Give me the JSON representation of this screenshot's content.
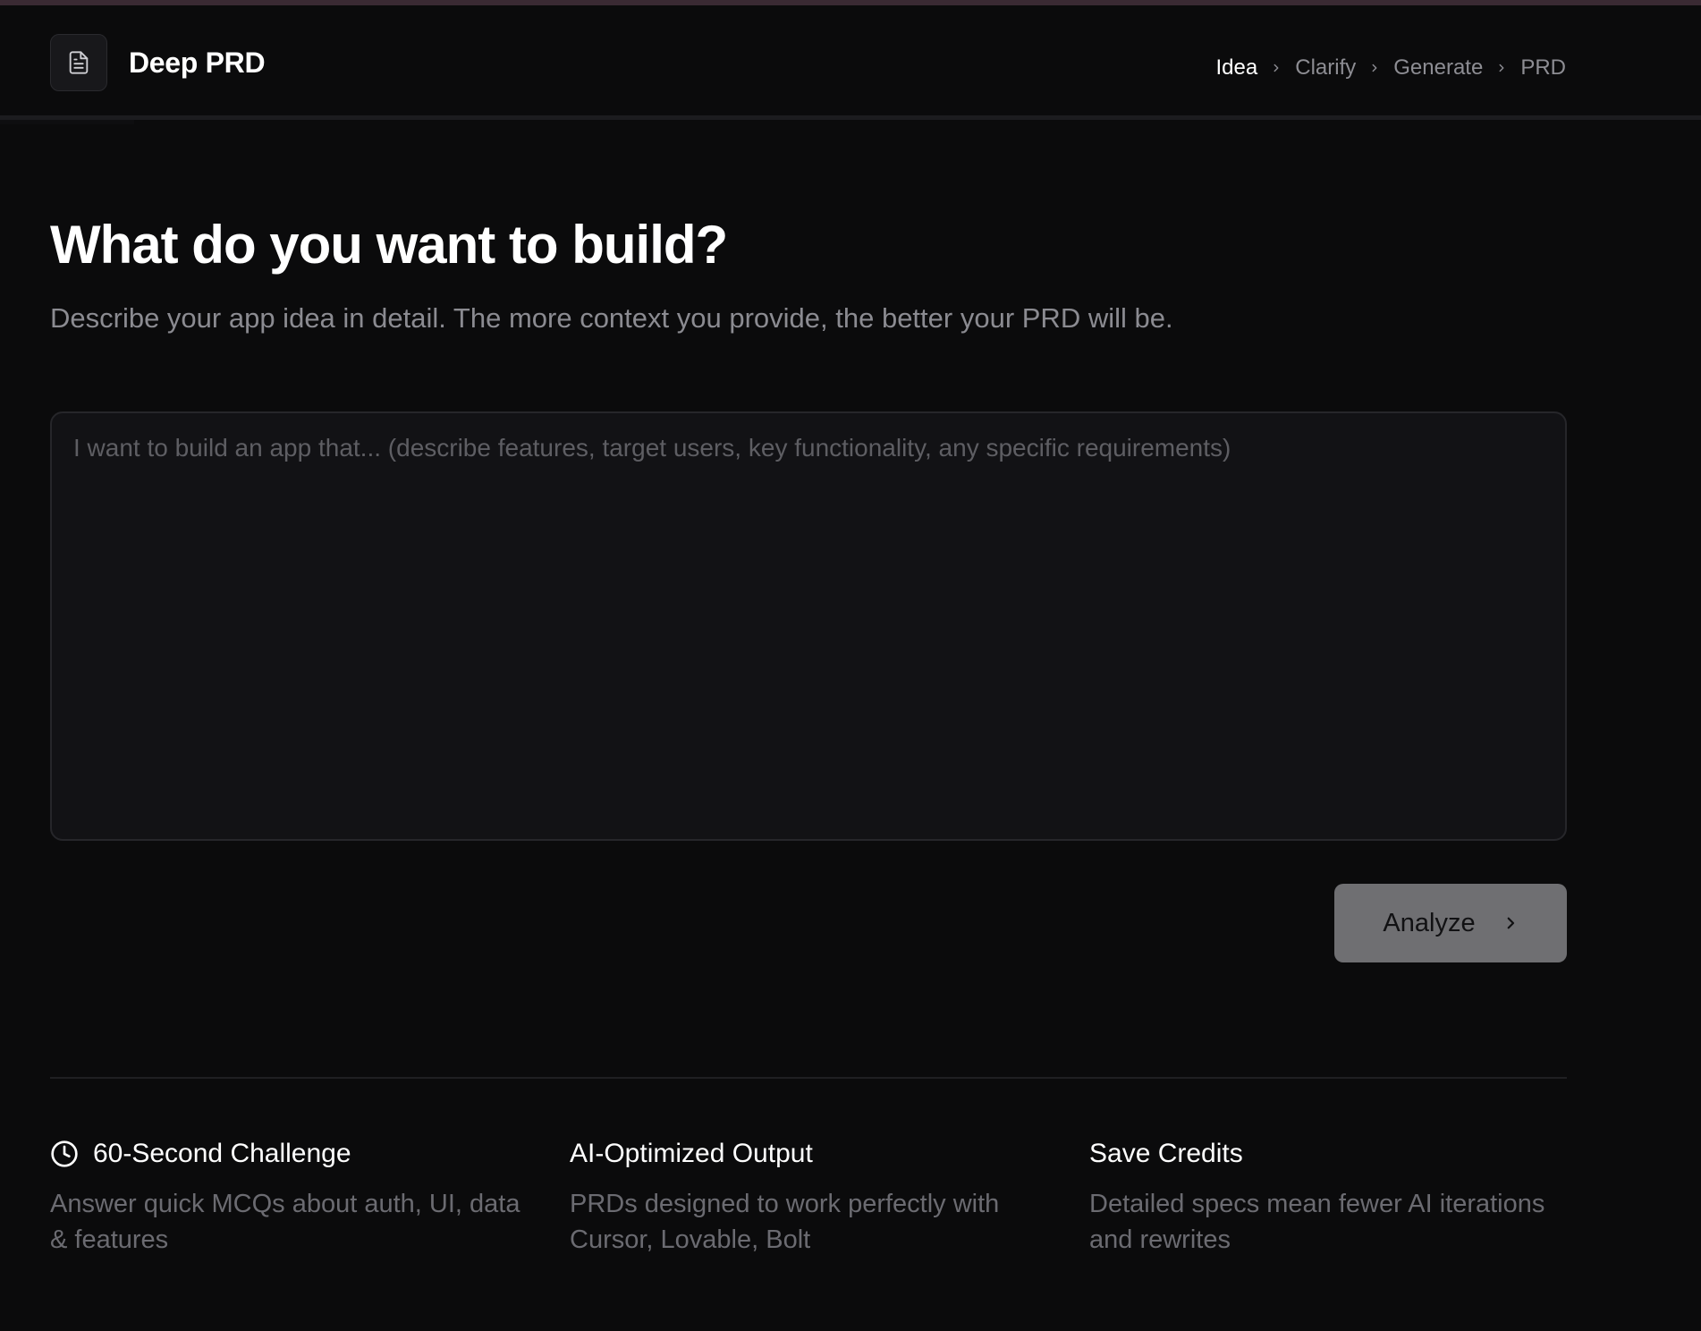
{
  "app": {
    "title": "Deep PRD",
    "logo_icon": "document-icon"
  },
  "breadcrumb": {
    "steps": [
      {
        "label": "Idea",
        "active": true
      },
      {
        "label": "Clarify",
        "active": false
      },
      {
        "label": "Generate",
        "active": false
      },
      {
        "label": "PRD",
        "active": false
      }
    ]
  },
  "hero": {
    "title": "What do you want to build?",
    "subtitle": "Describe your app idea in detail. The more context you provide, the better your PRD will be."
  },
  "idea_input": {
    "value": "",
    "placeholder": "I want to build an app that... (describe features, target users, key functionality, any specific requirements)"
  },
  "actions": {
    "analyze_label": "Analyze",
    "analyze_icon": "chevron-right-icon"
  },
  "features": [
    {
      "title": "60-Second Challenge",
      "icon": "clock-icon",
      "description": "Answer quick MCQs about auth, UI, data & features"
    },
    {
      "title": "AI-Optimized Output",
      "description": "PRDs designed to work perfectly with Cursor, Lovable, Bolt"
    },
    {
      "title": "Save Credits",
      "description": "Detailed specs mean fewer AI iterations and rewrites"
    }
  ],
  "colors": {
    "background": "#0b0b0c",
    "panel": "#121215",
    "muted_text": "#8b8b91",
    "button_bg": "#6f6f72"
  }
}
